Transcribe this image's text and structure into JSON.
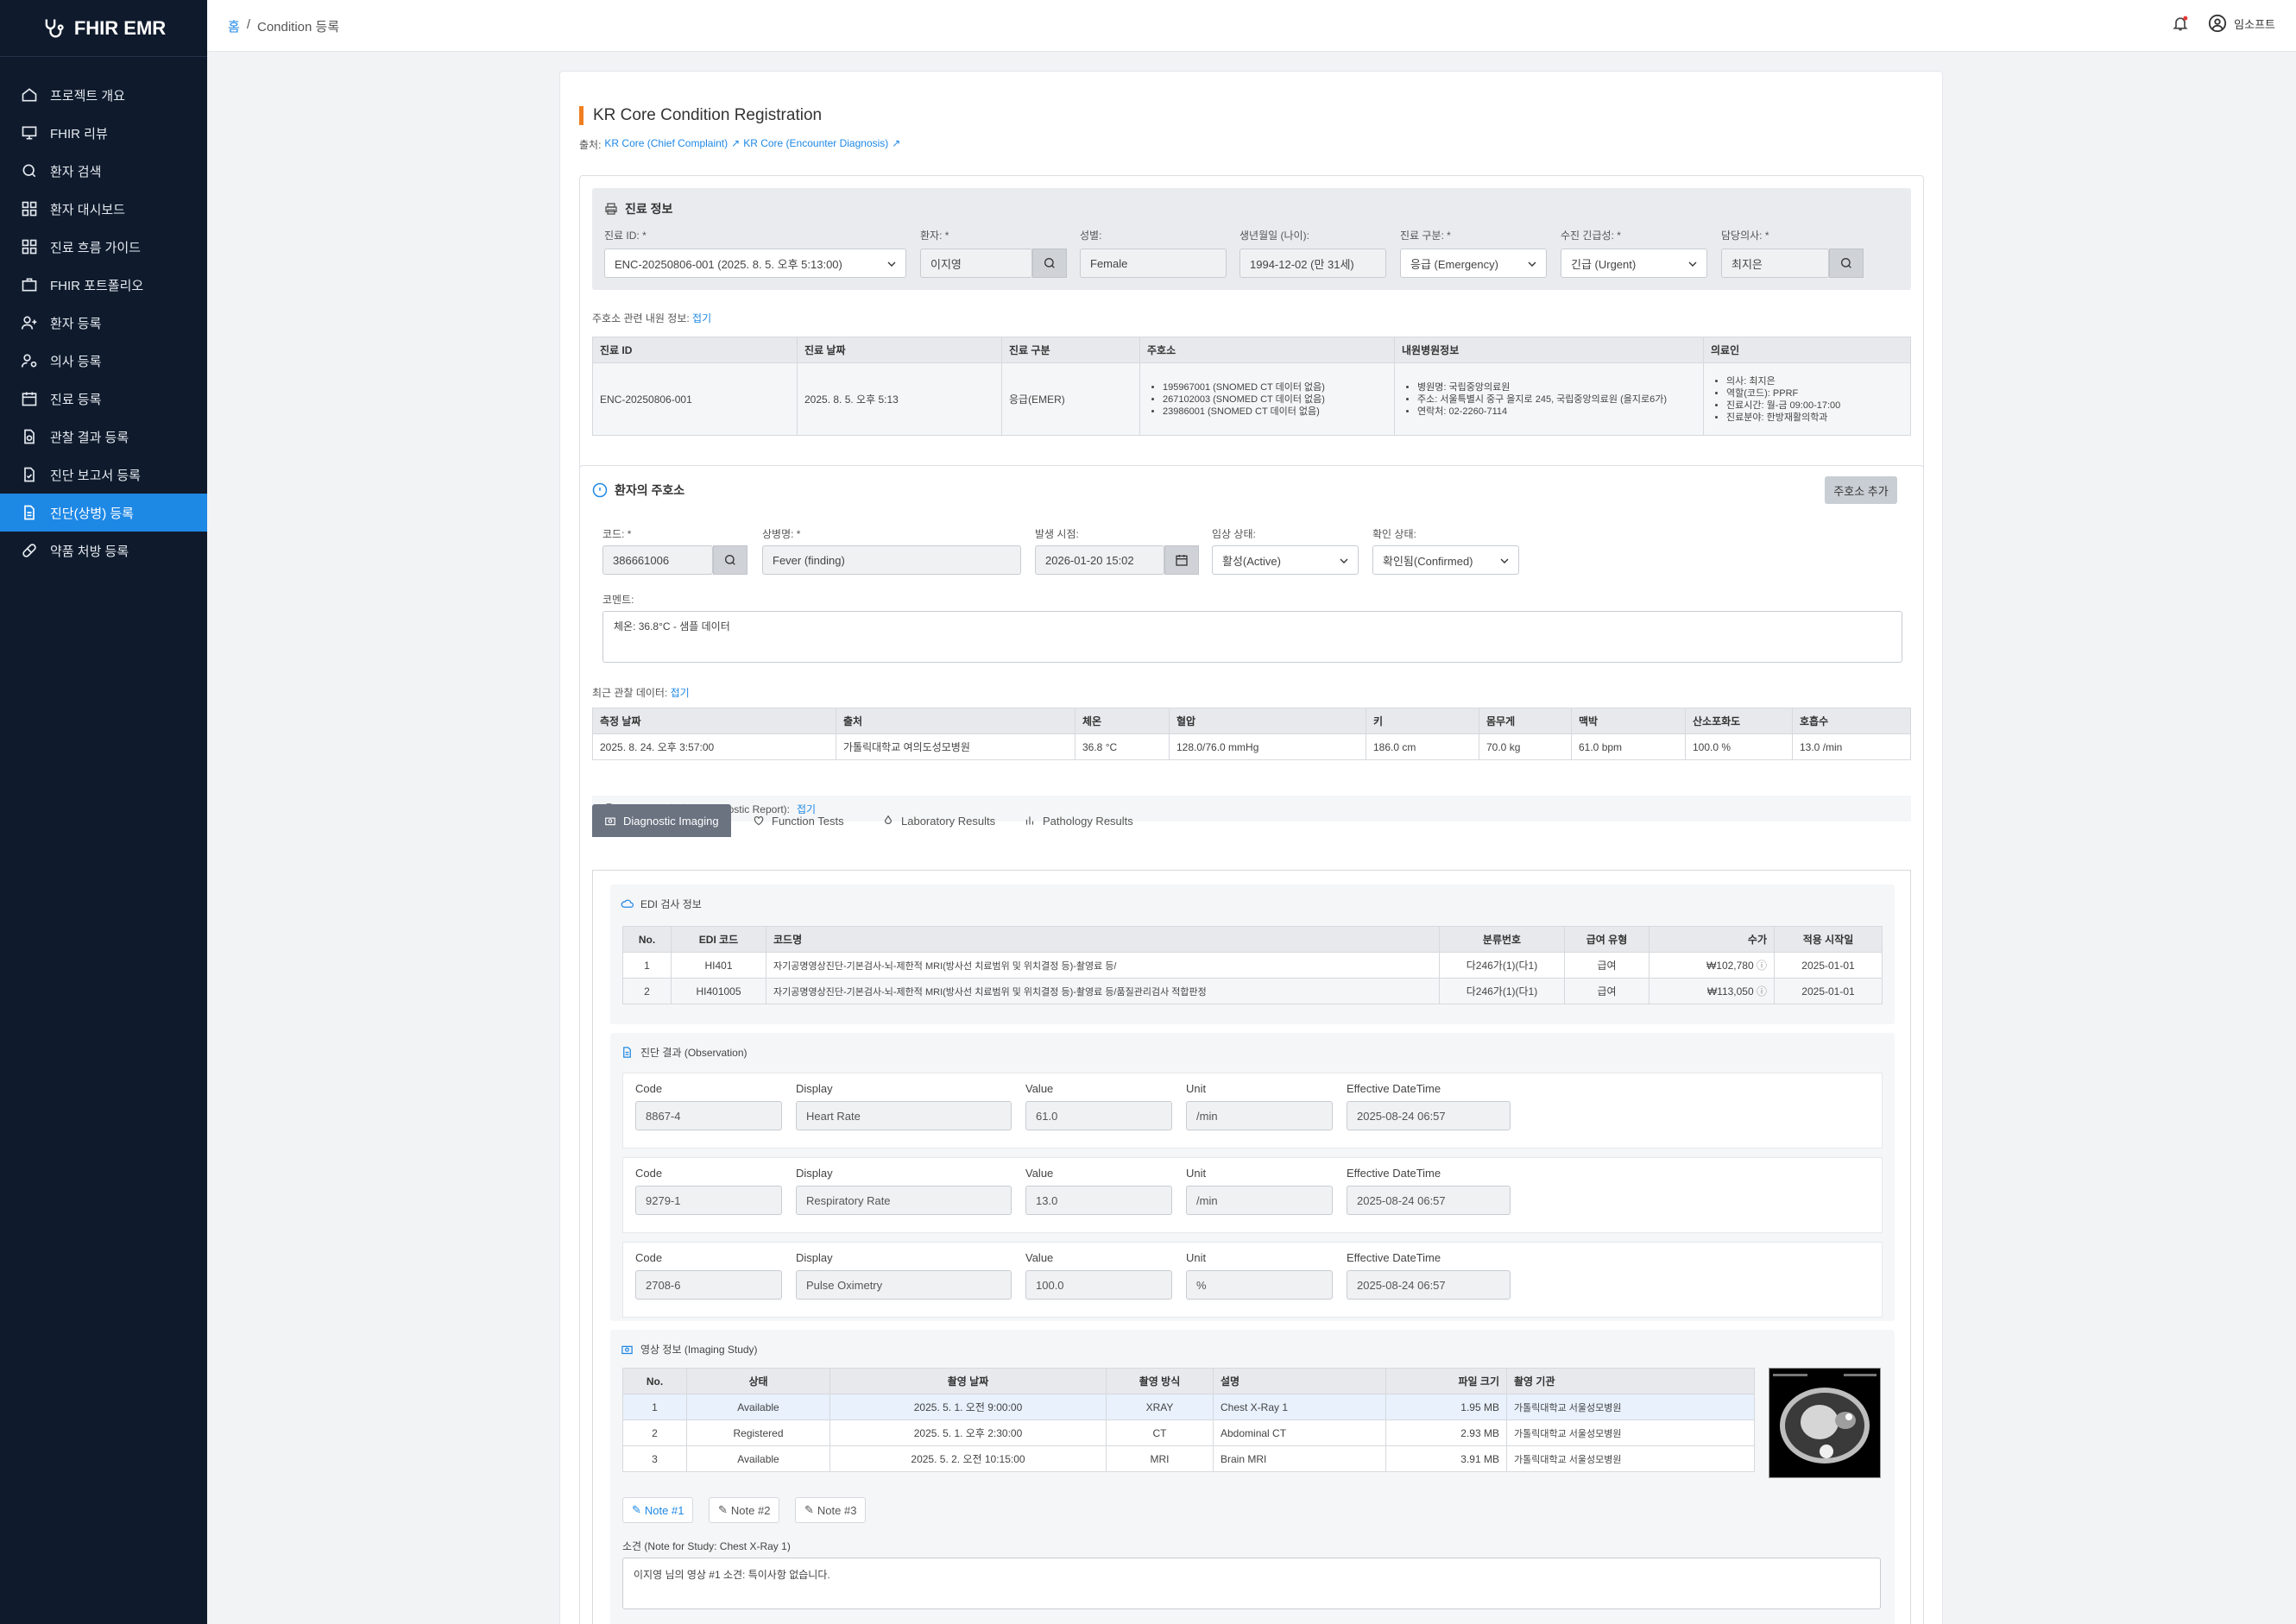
{
  "app": {
    "logo": "FHIR EMR"
  },
  "sidebar": {
    "items": [
      {
        "label": "프로젝트 개요",
        "icon": "home-icon"
      },
      {
        "label": "FHIR 리뷰",
        "icon": "presentation-icon"
      },
      {
        "label": "환자 검색",
        "icon": "search-icon"
      },
      {
        "label": "환자 대시보드",
        "icon": "grid-icon"
      },
      {
        "label": "진료 흐름 가이드",
        "icon": "grid-icon"
      },
      {
        "label": "FHIR 포트폴리오",
        "icon": "briefcase-icon"
      },
      {
        "label": "환자 등록",
        "icon": "user-plus-icon"
      },
      {
        "label": "의사 등록",
        "icon": "user-gear-icon"
      },
      {
        "label": "진료 등록",
        "icon": "calendar-icon"
      },
      {
        "label": "관찰 결과 등록",
        "icon": "file-search-icon"
      },
      {
        "label": "진단 보고서 등록",
        "icon": "file-check-icon"
      },
      {
        "label": "진단(상병) 등록",
        "icon": "document-icon"
      },
      {
        "label": "약품 처방 등록",
        "icon": "pill-icon"
      }
    ],
    "active_index": 11
  },
  "topbar": {
    "home": "홈",
    "sep": "/",
    "current": "Condition 등록",
    "user": "임소프트"
  },
  "page": {
    "title": "KR Core Condition Registration",
    "source_prefix": "출처:",
    "source1": "KR Core (Chief Complaint)",
    "source2": "KR Core (Encounter Diagnosis)"
  },
  "encounter": {
    "section_title": "진료 정보",
    "fields": {
      "enc_label": "진료 ID: *",
      "enc_value": "ENC-20250806-001 (2025. 8. 5. 오후 5:13:00)",
      "patient_label": "환자: *",
      "patient_value": "이지영",
      "gender_label": "성별:",
      "gender_value": "Female",
      "birth_label": "생년월일 (나이):",
      "birth_value": "1994-12-02 (만 31세)",
      "class_label": "진료 구분: *",
      "class_value": "응급 (Emergency)",
      "priority_label": "수진 긴급성: *",
      "priority_value": "긴급 (Urgent)",
      "doctor_label": "담당의사: *",
      "doctor_value": "최지은"
    },
    "history_label": "주호소 관련 내원 정보:",
    "history_toggle": "접기",
    "table": {
      "headers": [
        "진료 ID",
        "진료 날짜",
        "진료 구분",
        "주호소",
        "내원병원정보",
        "의료인"
      ],
      "row": {
        "id": "ENC-20250806-001",
        "date": "2025. 8. 5. 오후 5:13",
        "class": "응급(EMER)",
        "complaints": [
          "195967001 (SNOMED CT 데이터 없음)",
          "267102003 (SNOMED CT 데이터 없음)",
          "23986001 (SNOMED CT 데이터 없음)"
        ],
        "hospital": [
          "병원명: 국립중앙의료원",
          "주소: 서울특별시 중구 을지로 245, 국립중앙의료원 (을지로6가)",
          "연락처: 02-2260-7114"
        ],
        "practitioner": [
          "의사: 최지은",
          "역할(코드): PPRF",
          "진료시간: 월-금 09:00-17:00",
          "진료분야: 한방재활의학과"
        ]
      }
    }
  },
  "complaint": {
    "section_title": "환자의 주호소",
    "add_button": "주호소 추가",
    "code_label": "코드: *",
    "code_value": "386661006",
    "name_label": "상병명: *",
    "name_value": "Fever (finding)",
    "onset_label": "발생 시점:",
    "onset_value": "2026-01-20 15:02",
    "clinical_label": "임상 상태:",
    "clinical_value": "활성(Active)",
    "verify_label": "확인 상태:",
    "verify_value": "확인됨(Confirmed)",
    "comment_label": "코멘트:",
    "comment_value": "체온: 36.8°C - 샘플 데이터"
  },
  "observations": {
    "label": "최근 관찰 데이터:",
    "toggle": "접기",
    "headers": [
      "측정 날짜",
      "출처",
      "체온",
      "혈압",
      "키",
      "몸무게",
      "맥박",
      "산소포화도",
      "호흡수"
    ],
    "row": [
      "2025. 8. 24. 오후 3:57:00",
      "가톨릭대학교 여의도성모병원",
      "36.8 °C",
      "128.0/76.0 mmHg",
      "186.0 cm",
      "70.0 kg",
      "61.0 bpm",
      "100.0 %",
      "13.0 /min"
    ]
  },
  "diag": {
    "label": "진단 보고서 내역 (Diagnostic Report):",
    "toggle": "접기",
    "tabs": [
      "Diagnostic Imaging",
      "Function Tests",
      "Laboratory Results",
      "Pathology Results"
    ],
    "edi": {
      "title": "EDI 검사 정보",
      "headers": [
        "No.",
        "EDI 코드",
        "코드명",
        "분류번호",
        "급여 유형",
        "수가",
        "적용 시작일"
      ],
      "rows": [
        [
          "1",
          "HI401",
          "자기공명영상진단-기본검사-뇌-제한적 MRI(방사선 치료범위 및 위치결정 등)-촬영료 등/",
          "다246가(1)(다1)",
          "급여",
          "₩102,780",
          "2025-01-01"
        ],
        [
          "2",
          "HI401005",
          "자기공명영상진단-기본검사-뇌-제한적 MRI(방사선 치료범위 및 위치결정 등)-촬영료 등/품질관리검사 적합판정",
          "다246가(1)(다1)",
          "급여",
          "₩113,050",
          "2025-01-01"
        ]
      ]
    },
    "obs": {
      "title": "진단 결과 (Observation)",
      "labels": {
        "code": "Code",
        "display": "Display",
        "value": "Value",
        "unit": "Unit",
        "time": "Effective DateTime"
      },
      "rows": [
        {
          "code": "8867-4",
          "display": "Heart Rate",
          "value": "61.0",
          "unit": "/min",
          "time": "2025-08-24 06:57"
        },
        {
          "code": "9279-1",
          "display": "Respiratory Rate",
          "value": "13.0",
          "unit": "/min",
          "time": "2025-08-24 06:57"
        },
        {
          "code": "2708-6",
          "display": "Pulse Oximetry",
          "value": "100.0",
          "unit": "%",
          "time": "2025-08-24 06:57"
        }
      ]
    },
    "img": {
      "title": "영상 정보 (Imaging Study)",
      "headers": [
        "No.",
        "상태",
        "촬영 날짜",
        "촬영 방식",
        "설명",
        "파일 크기",
        "촬영 기관"
      ],
      "rows": [
        [
          "1",
          "Available",
          "2025. 5. 1. 오전 9:00:00",
          "XRAY",
          "Chest X-Ray 1",
          "1.95 MB",
          "가톨릭대학교 서울성모병원"
        ],
        [
          "2",
          "Registered",
          "2025. 5. 1. 오후 2:30:00",
          "CT",
          "Abdominal CT",
          "2.93 MB",
          "가톨릭대학교 서울성모병원"
        ],
        [
          "3",
          "Available",
          "2025. 5. 2. 오전 10:15:00",
          "MRI",
          "Brain MRI",
          "3.91 MB",
          "가톨릭대학교 서울성모병원"
        ]
      ],
      "notes": [
        "Note #1",
        "Note #2",
        "Note #3"
      ],
      "note_label": "소견 (Note for Study: Chest X-Ray 1)",
      "note_text": "이지영 님의 영상 #1 소견: 특이사항 없습니다."
    }
  }
}
